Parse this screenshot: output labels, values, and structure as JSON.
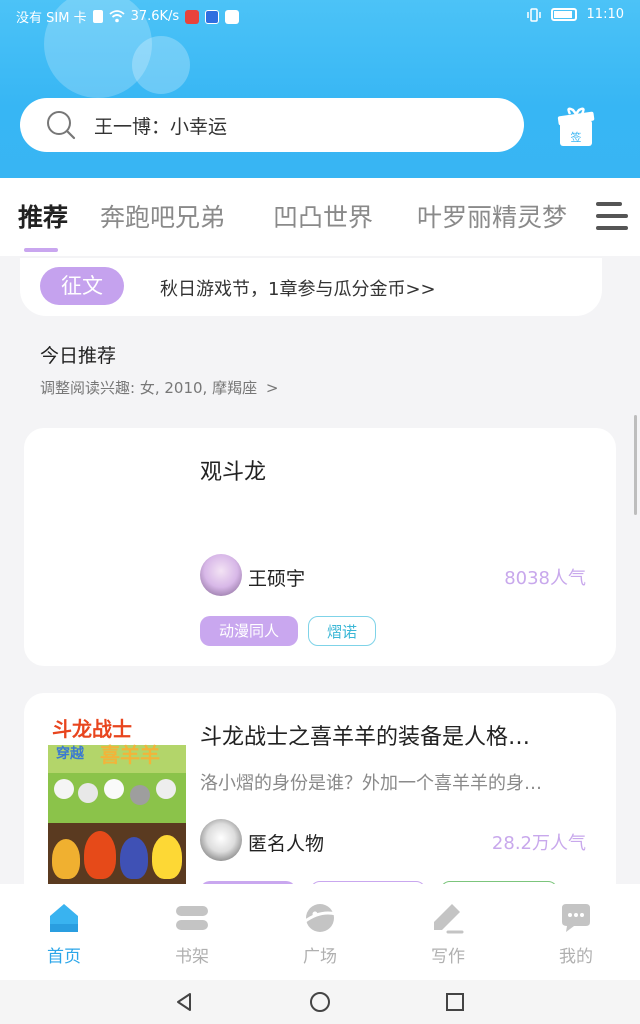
{
  "status_bar": {
    "carrier": "没有 SIM 卡",
    "speed": "37.6K/s",
    "time": "11:10"
  },
  "search": {
    "placeholder": "王一博：小幸运"
  },
  "tabs": [
    {
      "label": "推荐",
      "active": true
    },
    {
      "label": "奔跑吧兄弟",
      "active": false
    },
    {
      "label": "凹凸世界",
      "active": false
    },
    {
      "label": "叶罗丽精灵梦",
      "active": false
    }
  ],
  "banner": {
    "pill": "征文",
    "text": "秋日游戏节，1章参与瓜分金币>>"
  },
  "section": {
    "title": "今日推荐",
    "subtitle": "调整阅读兴趣: 女, 2010, 摩羯座"
  },
  "books": [
    {
      "title": "观斗龙",
      "description": "",
      "author": "王硕宇",
      "popularity": "8038人气",
      "tags": [
        "动漫同人",
        "熠诺"
      ]
    },
    {
      "title": "斗龙战士之喜羊羊的装备是人格…",
      "description": "洛小熠的身份是谁？外加一个喜羊羊的身…",
      "author": "匿名人物",
      "popularity": "28.2万人气",
      "tags": []
    }
  ],
  "cover_text": {
    "line1": "斗龙战士",
    "line2": "穿越",
    "line3": "喜羊羊"
  },
  "bottom_nav": [
    {
      "label": "首页",
      "icon": "home-icon",
      "active": true
    },
    {
      "label": "书架",
      "icon": "bookshelf-icon",
      "active": false
    },
    {
      "label": "广场",
      "icon": "planet-icon",
      "active": false
    },
    {
      "label": "写作",
      "icon": "pen-icon",
      "active": false
    },
    {
      "label": "我的",
      "icon": "chat-bubble-icon",
      "active": false
    }
  ],
  "colors": {
    "header": "#38b5f3",
    "accent_purple": "#c5a2ee",
    "nav_active": "#2ba6e9"
  }
}
